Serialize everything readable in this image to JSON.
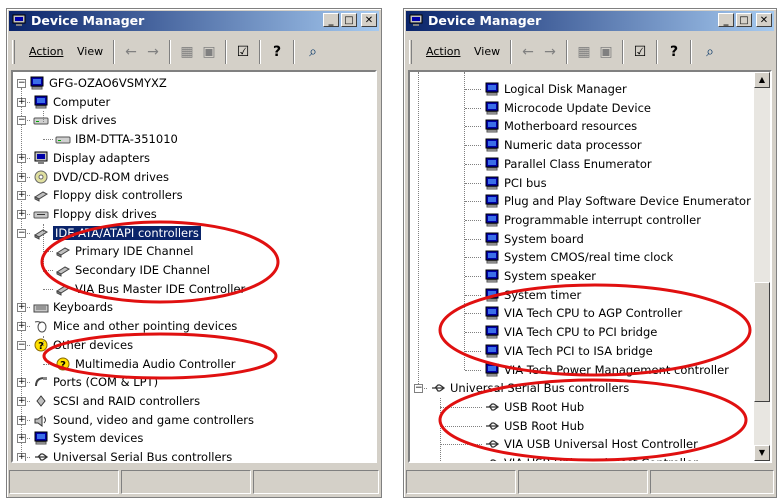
{
  "left_window": {
    "title": "Device Manager",
    "menu": {
      "action": "Action",
      "view": "View"
    },
    "tree": {
      "root": "GFG-OZAO6VSMYXZ",
      "items": [
        {
          "label": "Computer",
          "icon": "computer-icon",
          "expander": "+"
        },
        {
          "label": "Disk drives",
          "icon": "disk-icon",
          "expander": "-"
        },
        {
          "label": "IBM-DTTA-351010",
          "icon": "disk-icon",
          "child": true
        },
        {
          "label": "Display adapters",
          "icon": "monitor-icon",
          "expander": "+"
        },
        {
          "label": "DVD/CD-ROM drives",
          "icon": "cdrom-icon",
          "expander": "+"
        },
        {
          "label": "Floppy disk controllers",
          "icon": "controller-icon",
          "expander": "+"
        },
        {
          "label": "Floppy disk drives",
          "icon": "floppy-icon",
          "expander": "+"
        },
        {
          "label": "IDE ATA/ATAPI controllers",
          "icon": "controller-icon",
          "expander": "-",
          "selected": true
        },
        {
          "label": "Primary IDE Channel",
          "icon": "controller-icon",
          "child": true
        },
        {
          "label": "Secondary IDE Channel",
          "icon": "controller-icon",
          "child": true
        },
        {
          "label": "VIA Bus Master IDE Controller",
          "icon": "controller-icon",
          "child": true
        },
        {
          "label": "Keyboards",
          "icon": "keyboard-icon",
          "expander": "+"
        },
        {
          "label": "Mice and other pointing devices",
          "icon": "mouse-icon",
          "expander": "+"
        },
        {
          "label": "Other devices",
          "icon": "question-icon",
          "expander": "-"
        },
        {
          "label": "Multimedia Audio Controller",
          "icon": "question-icon",
          "child": true
        },
        {
          "label": "Ports (COM & LPT)",
          "icon": "port-icon",
          "expander": "+"
        },
        {
          "label": "SCSI and RAID controllers",
          "icon": "scsi-icon",
          "expander": "+"
        },
        {
          "label": "Sound, video and game controllers",
          "icon": "sound-icon",
          "expander": "+"
        },
        {
          "label": "System devices",
          "icon": "computer-icon",
          "expander": "+"
        },
        {
          "label": "Universal Serial Bus controllers",
          "icon": "usb-icon",
          "expander": "+"
        }
      ]
    }
  },
  "right_window": {
    "title": "Device Manager",
    "menu": {
      "action": "Action",
      "view": "View"
    },
    "tree": {
      "items": [
        {
          "label": "Logical Disk Manager",
          "icon": "computer-icon"
        },
        {
          "label": "Microcode Update Device",
          "icon": "computer-icon"
        },
        {
          "label": "Motherboard resources",
          "icon": "computer-icon"
        },
        {
          "label": "Numeric data processor",
          "icon": "computer-icon"
        },
        {
          "label": "Parallel Class Enumerator",
          "icon": "computer-icon"
        },
        {
          "label": "PCI bus",
          "icon": "computer-icon"
        },
        {
          "label": "Plug and Play Software Device Enumerator",
          "icon": "computer-icon"
        },
        {
          "label": "Programmable interrupt controller",
          "icon": "computer-icon"
        },
        {
          "label": "System board",
          "icon": "computer-icon"
        },
        {
          "label": "System CMOS/real time clock",
          "icon": "computer-icon"
        },
        {
          "label": "System speaker",
          "icon": "computer-icon"
        },
        {
          "label": "System timer",
          "icon": "computer-icon"
        },
        {
          "label": "VIA Tech CPU to AGP Controller",
          "icon": "computer-icon"
        },
        {
          "label": "VIA Tech CPU to PCI bridge",
          "icon": "computer-icon"
        },
        {
          "label": "VIA Tech PCI to ISA bridge",
          "icon": "computer-icon"
        },
        {
          "label": "VIA Tech Power Management controller",
          "icon": "computer-icon"
        },
        {
          "label": "Universal Serial Bus controllers",
          "icon": "usb-icon",
          "expander": "-",
          "parent": true
        },
        {
          "label": "USB Root Hub",
          "icon": "usb-icon"
        },
        {
          "label": "USB Root Hub",
          "icon": "usb-icon"
        },
        {
          "label": "VIA USB Universal Host Controller",
          "icon": "usb-icon"
        },
        {
          "label": "VIA USB Universal Host Controller",
          "icon": "usb-icon"
        }
      ]
    }
  },
  "colors": {
    "annotation": "#e01010",
    "selection": "#0a246a",
    "titlebar": "#0a246a"
  }
}
